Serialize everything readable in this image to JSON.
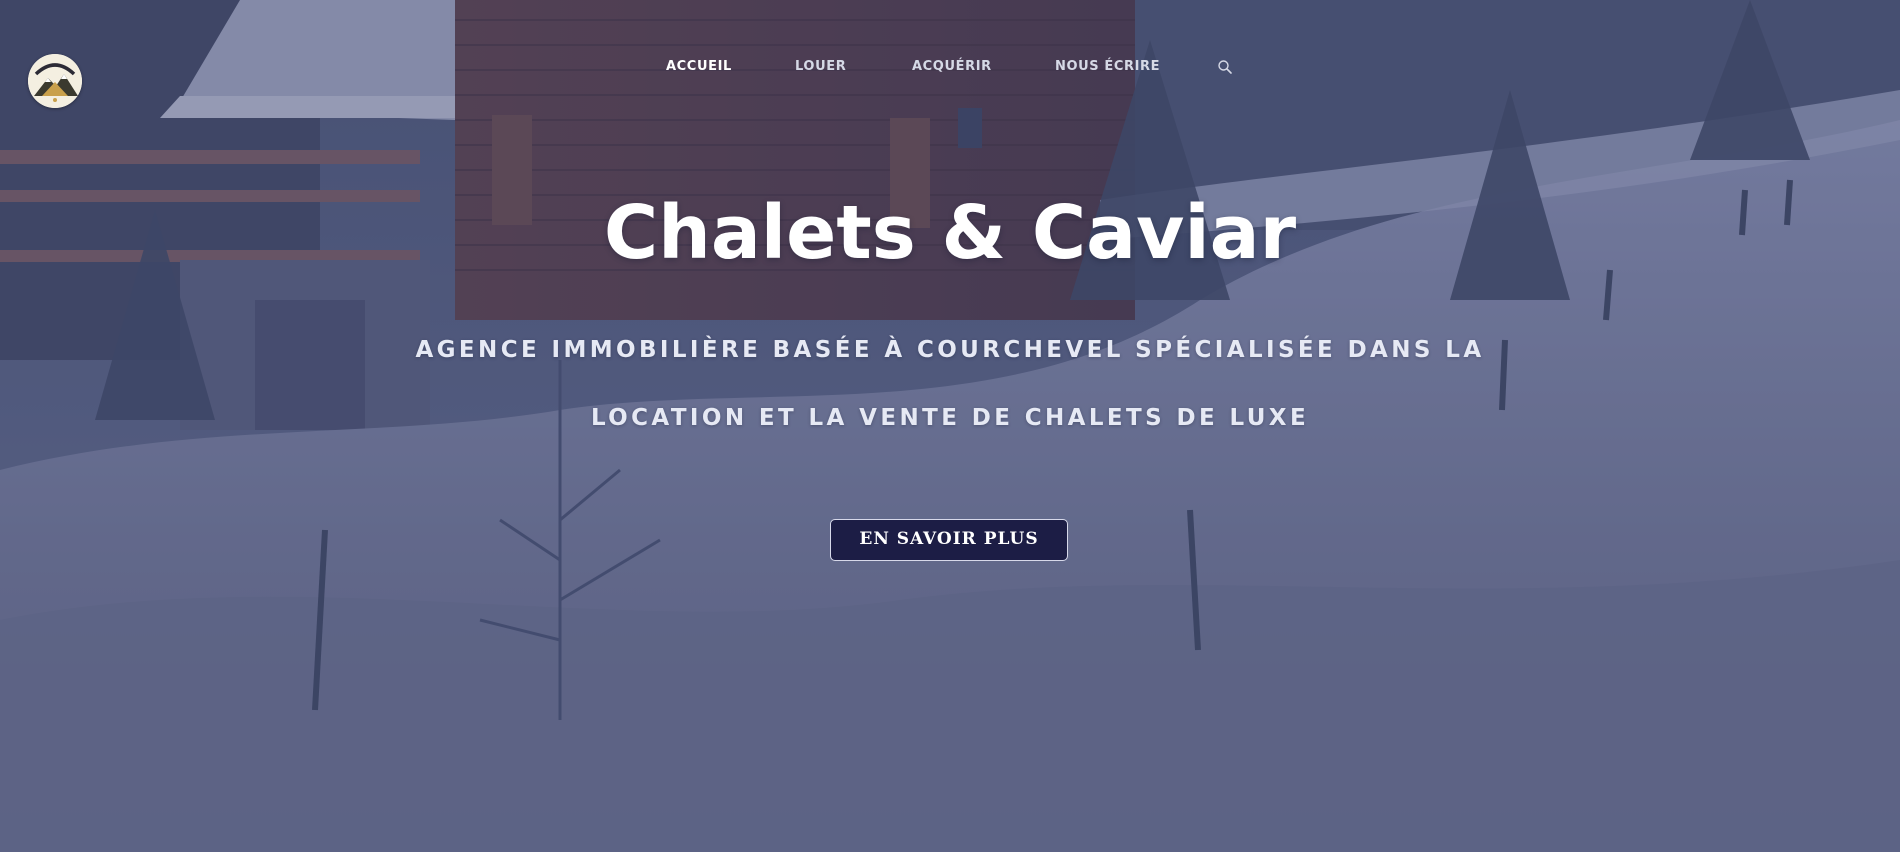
{
  "brand": {
    "logo_icon": "chalet-mountain-logo",
    "logo_text": "Chalets & Caviar"
  },
  "nav": {
    "items": [
      {
        "label": "ACCUEIL",
        "active": true
      },
      {
        "label": "LOUER",
        "active": false
      },
      {
        "label": "ACQUÉRIR",
        "active": false
      },
      {
        "label": "NOUS ÉCRIRE",
        "active": false
      }
    ],
    "search_icon": "search-icon"
  },
  "hero": {
    "title": "Chalets & Caviar",
    "subtitle_line1": "AGENCE IMMOBILIÈRE BASÉE À COURCHEVEL SPÉCIALISÉE DANS LA",
    "subtitle_line2": "LOCATION ET LA VENTE DE CHALETS DE LUXE",
    "cta_label": "EN SAVOIR PLUS"
  },
  "colors": {
    "overlay": "#3e446e",
    "button_bg": "#1c1d45",
    "text": "#ffffff"
  }
}
